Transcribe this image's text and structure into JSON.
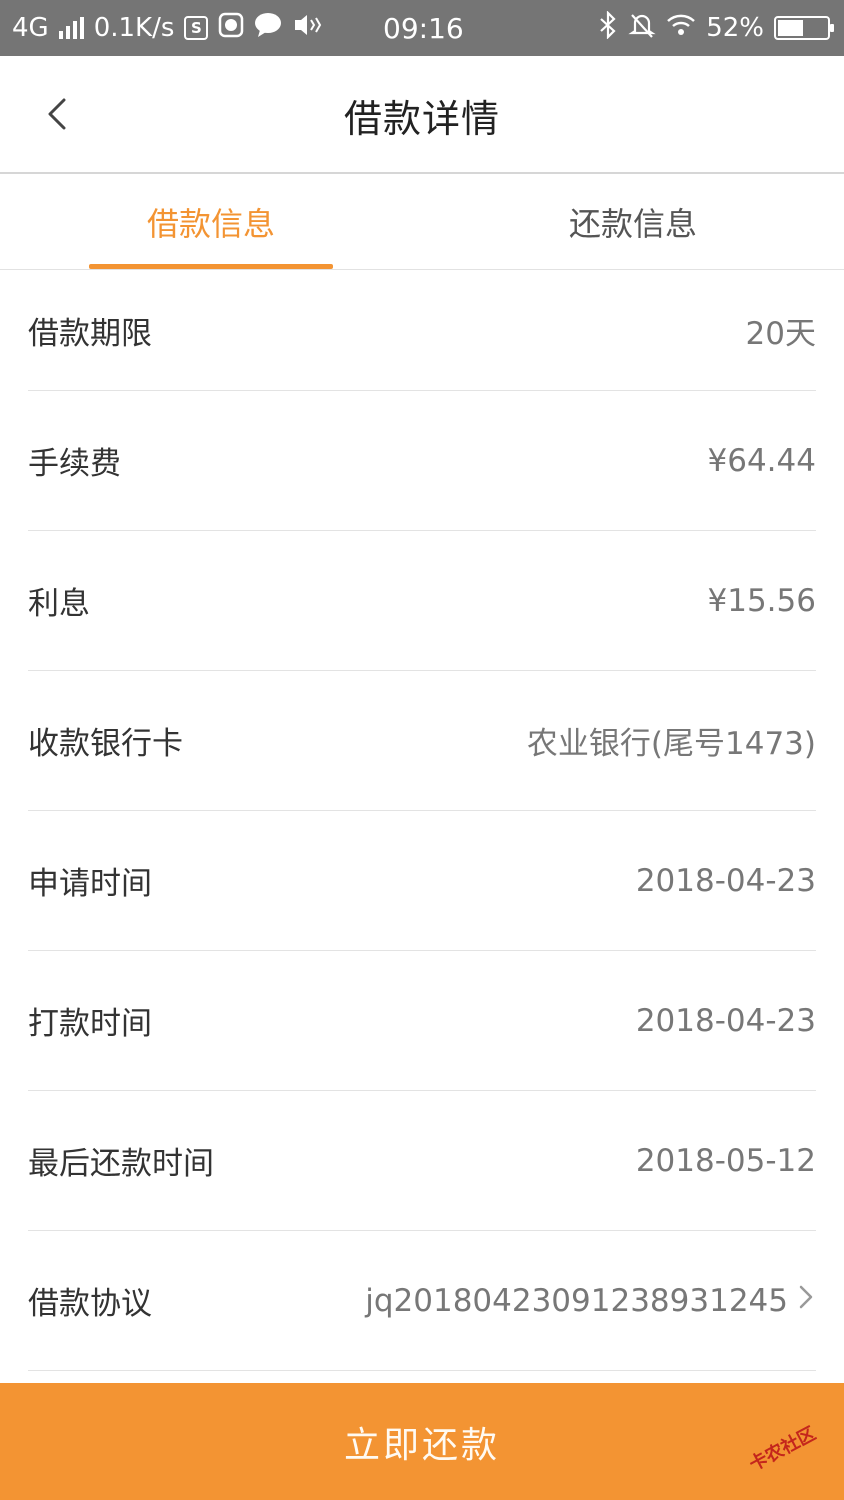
{
  "status_bar": {
    "network": "4G",
    "speed": "0.1K/s",
    "time": "09:16",
    "battery": "52%",
    "battery_level": 0.52,
    "icon_s": "S"
  },
  "header": {
    "title": "借款详情"
  },
  "tabs": [
    {
      "label": "借款信息",
      "active": true
    },
    {
      "label": "还款信息",
      "active": false
    }
  ],
  "details": [
    {
      "label": "借款期限",
      "value": "20天"
    },
    {
      "label": "手续费",
      "value": "¥64.44"
    },
    {
      "label": "利息",
      "value": "¥15.56"
    },
    {
      "label": "收款银行卡",
      "value": "农业银行(尾号1473)"
    },
    {
      "label": "申请时间",
      "value": "2018-04-23"
    },
    {
      "label": "打款时间",
      "value": "2018-04-23"
    },
    {
      "label": "最后还款时间",
      "value": "2018-05-12"
    },
    {
      "label": "借款协议",
      "value": "jq20180423091238931245"
    }
  ],
  "footer": {
    "repay_label": "立即还款"
  },
  "watermark": "卡农社区",
  "colors": {
    "accent": "#f39433",
    "status_bar": "#757575"
  }
}
